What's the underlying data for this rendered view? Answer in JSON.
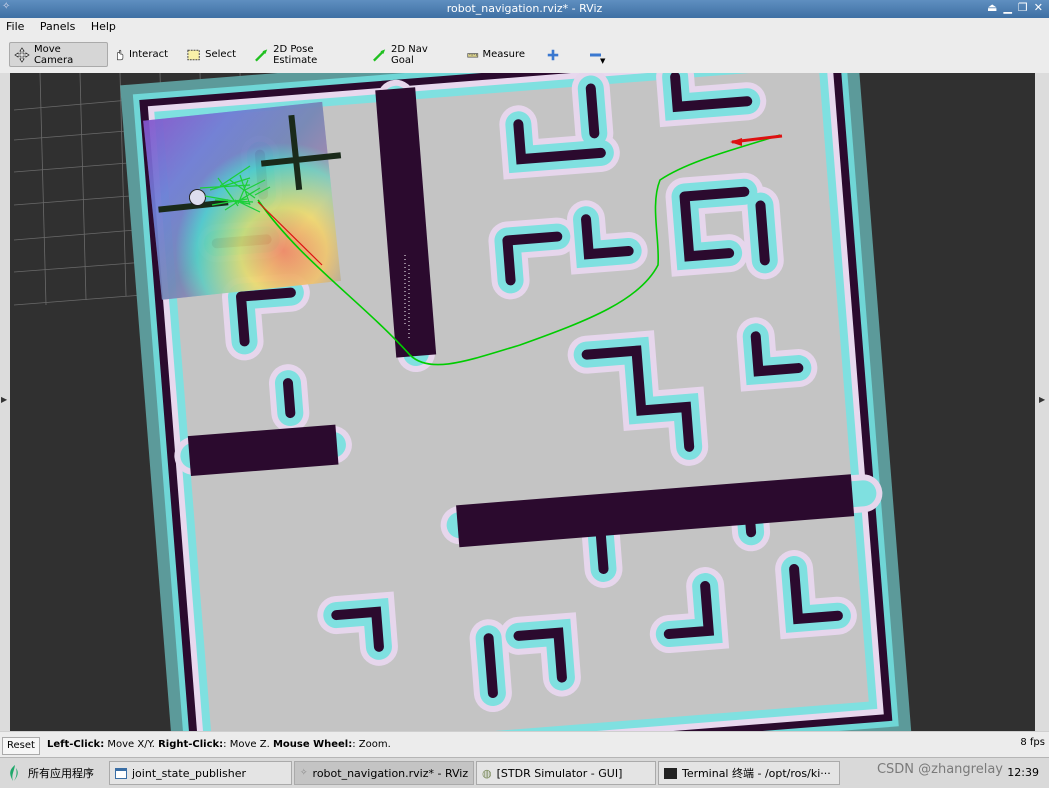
{
  "window": {
    "title": "robot_navigation.rviz* - RViz"
  },
  "menu": [
    "File",
    "Panels",
    "Help"
  ],
  "toolbar": {
    "move_camera": "Move Camera",
    "interact": "Interact",
    "select": "Select",
    "pose_estimate": "2D Pose Estimate",
    "nav_goal": "2D Nav Goal",
    "measure": "Measure"
  },
  "status": {
    "reset": "Reset",
    "hint_left_key": "Left-Click:",
    "hint_left_val": " Move X/Y. ",
    "hint_right_key": "Right-Click:",
    "hint_right_val": ": Move Z. ",
    "hint_wheel_key": "Mouse Wheel:",
    "hint_wheel_val": ": Zoom.",
    "fps": "8 fps"
  },
  "taskbar": {
    "start": "所有应用程序",
    "tasks": [
      "joint_state_publisher",
      "robot_navigation.rviz* - RViz",
      "[STDR Simulator - GUI]",
      "Terminal 终端 - /opt/ros/ki···"
    ],
    "clock": "12:39",
    "watermark": "CSDN @zhangrelay"
  },
  "colors": {
    "map_free": "#c4c4c4",
    "map_wall": "#2b0a2e",
    "inflation": "#7fe0e0",
    "path": "#00cc00",
    "arrow": "#dd1111"
  }
}
